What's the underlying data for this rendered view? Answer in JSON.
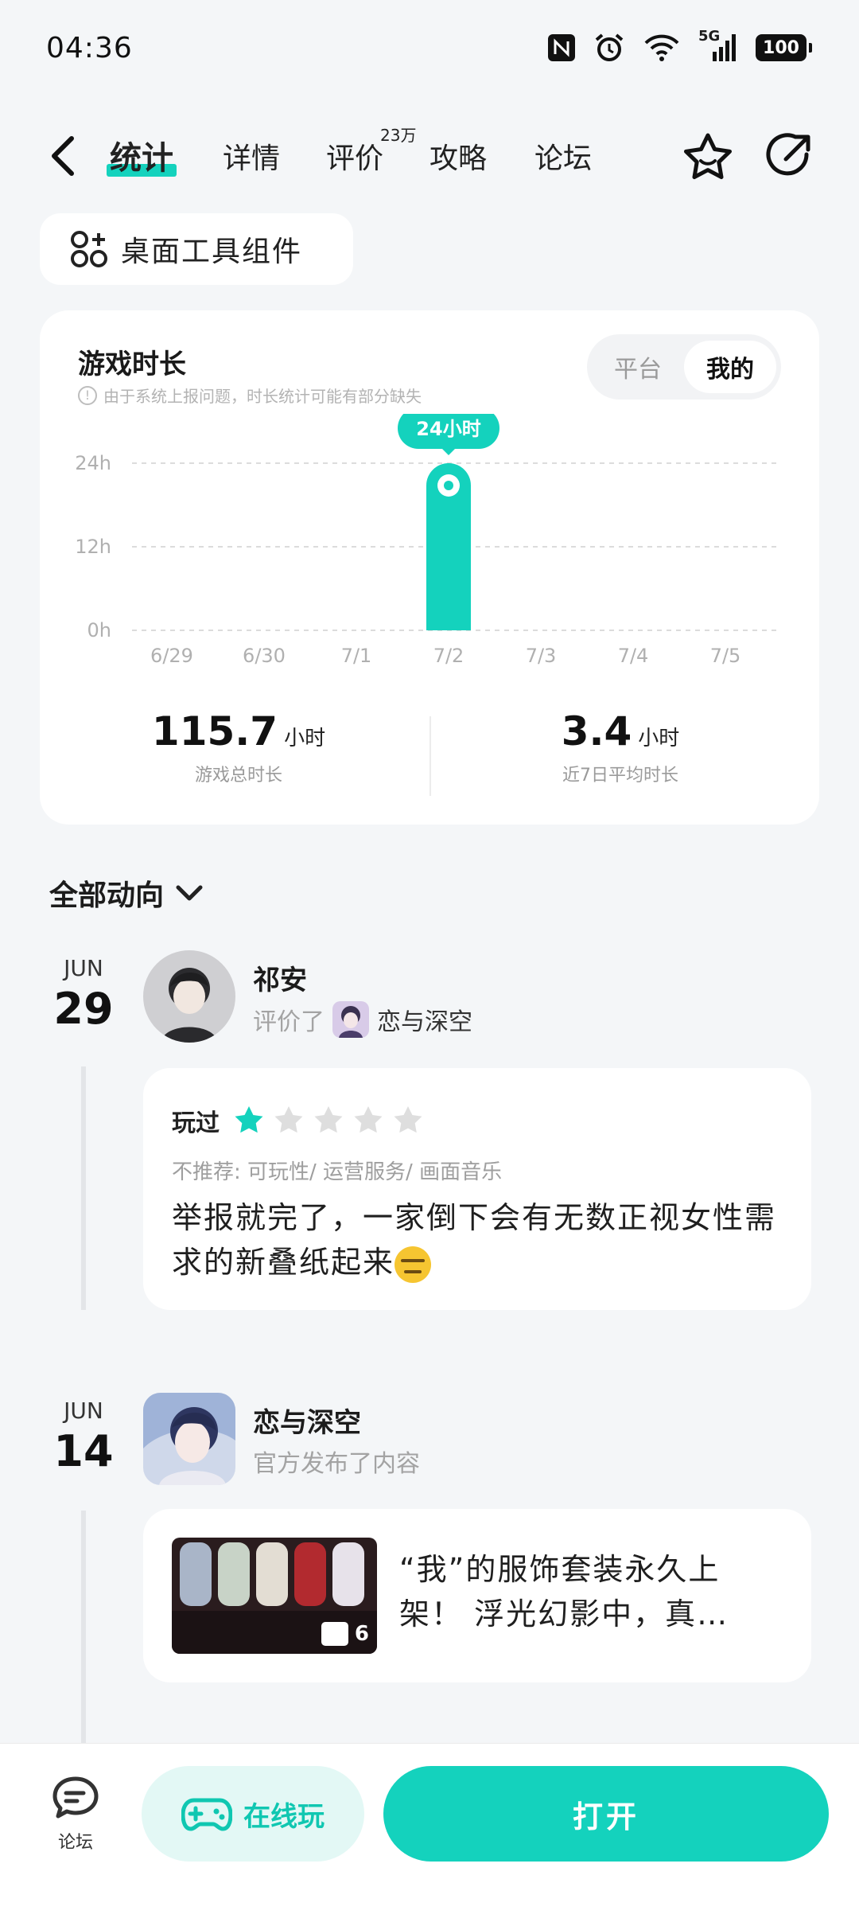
{
  "status_bar": {
    "time": "04:36",
    "network": "5G",
    "battery": "100"
  },
  "nav": {
    "tabs": [
      {
        "label": "统计",
        "active": true
      },
      {
        "label": "详情"
      },
      {
        "label": "评价",
        "badge": "23万"
      },
      {
        "label": "攻略"
      },
      {
        "label": "论坛"
      }
    ]
  },
  "widget_button": {
    "label": "桌面工具组件"
  },
  "stats_card": {
    "title": "游戏时长",
    "note": "由于系统上报问题，时长统计可能有部分缺失",
    "toggle": {
      "platform": "平台",
      "mine": "我的",
      "selected": "我的"
    },
    "tooltip": "24小时",
    "total": {
      "value": "115.7",
      "unit": "小时",
      "caption": "游戏总时长"
    },
    "average": {
      "value": "3.4",
      "unit": "小时",
      "caption": "近7日平均时长"
    }
  },
  "chart_data": {
    "type": "bar",
    "categories": [
      "6/29",
      "6/30",
      "7/1",
      "7/2",
      "7/3",
      "7/4",
      "7/5"
    ],
    "values": [
      0,
      0,
      0,
      24,
      0,
      0,
      0
    ],
    "yticks": [
      "24h",
      "12h",
      "0h"
    ],
    "ylim": [
      0,
      24
    ],
    "highlight_index": 3,
    "bar_color": "#14d2bd"
  },
  "feed": {
    "filter_label": "全部动向",
    "items": [
      {
        "month": "JUN",
        "day": "29",
        "user": "祁安",
        "action": "评价了",
        "game": "恋与深空",
        "played_label": "玩过",
        "rating": 1,
        "rating_max": 5,
        "tags": "不推荐: 可玩性/ 运营服务/ 画面音乐",
        "text": "举报就完了，一家倒下会有无数正视女性需求的新叠纸起来"
      },
      {
        "month": "JUN",
        "day": "14",
        "user": "恋与深空",
        "action": "官方发布了内容",
        "image_count": "6",
        "text": "“我”的服饰套装永久上架！ 浮光幻影中，真…"
      }
    ]
  },
  "bottom_bar": {
    "forum": "论坛",
    "online_play": "在线玩",
    "open": "打开"
  },
  "colors": {
    "accent": "#14d2bd",
    "background": "#f4f6f8"
  }
}
